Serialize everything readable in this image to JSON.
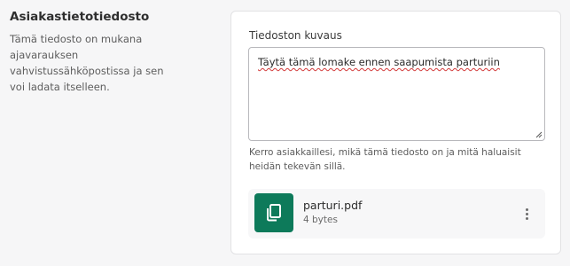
{
  "section": {
    "title": "Asiakastietotiedosto",
    "description": "Tämä tiedosto on mukana ajavarauksen vahvistussähköpostissa ja sen voi ladata itselleen."
  },
  "form": {
    "description_label": "Tiedoston kuvaus",
    "description_value": "Täytä tämä lomake ennen saapumista parturiin",
    "help_text": "Kerro asiakkaillesi, mikä tämä tiedosto on ja mitä haluaisit heidän tekevän sillä."
  },
  "file": {
    "name": "parturi.pdf",
    "size": "4 bytes",
    "icon": "file-copy-icon",
    "icon_bg_color": "#0d7a5a"
  },
  "icons": {
    "more": "more-vertical-icon"
  }
}
